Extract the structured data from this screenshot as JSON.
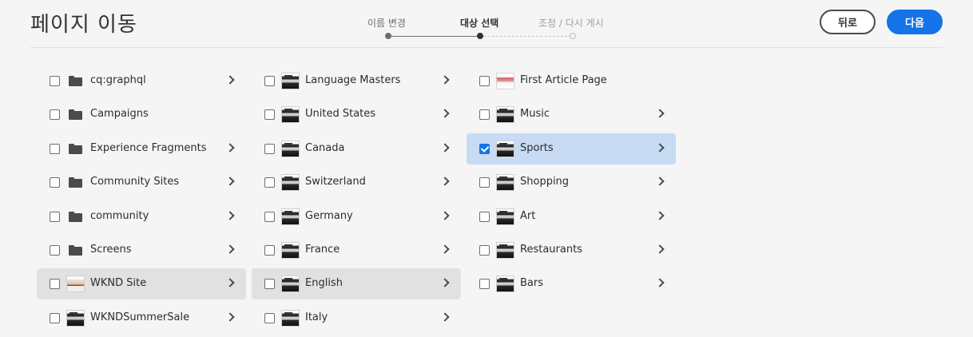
{
  "header": {
    "title": "페이지 이동",
    "steps": [
      {
        "label": "이름 변경",
        "state": "done"
      },
      {
        "label": "대상 선택",
        "state": "active"
      },
      {
        "label": "조정 / 다시 게시",
        "state": "future"
      }
    ],
    "back_label": "뒤로",
    "next_label": "다음"
  },
  "colors": {
    "accent": "#1473e6",
    "selected_row": "#c8dbf5",
    "path_row": "#e1e1e1"
  },
  "columns": [
    {
      "items": [
        {
          "label": "cq:graphql",
          "icon": "folder-icon",
          "has_children": true,
          "checked": false,
          "highlight": "none"
        },
        {
          "label": "Campaigns",
          "icon": "folder-icon",
          "has_children": false,
          "checked": false,
          "highlight": "none"
        },
        {
          "label": "Experience Fragments",
          "icon": "folder-icon",
          "has_children": true,
          "checked": false,
          "highlight": "none"
        },
        {
          "label": "Community Sites",
          "icon": "folder-icon",
          "has_children": true,
          "checked": false,
          "highlight": "none"
        },
        {
          "label": "community",
          "icon": "folder-icon",
          "has_children": true,
          "checked": false,
          "highlight": "none"
        },
        {
          "label": "Screens",
          "icon": "folder-icon",
          "has_children": true,
          "checked": false,
          "highlight": "none"
        },
        {
          "label": "WKND Site",
          "icon": "wknd-thumbnail-icon",
          "has_children": true,
          "checked": false,
          "highlight": "path"
        },
        {
          "label": "WKNDSummerSale",
          "icon": "page-thumbnail-icon",
          "has_children": true,
          "checked": false,
          "highlight": "none"
        }
      ]
    },
    {
      "items": [
        {
          "label": "Language Masters",
          "icon": "page-thumbnail-icon",
          "has_children": true,
          "checked": false,
          "highlight": "none"
        },
        {
          "label": "United States",
          "icon": "page-thumbnail-icon",
          "has_children": true,
          "checked": false,
          "highlight": "none"
        },
        {
          "label": "Canada",
          "icon": "page-thumbnail-icon",
          "has_children": true,
          "checked": false,
          "highlight": "none"
        },
        {
          "label": "Switzerland",
          "icon": "page-thumbnail-icon",
          "has_children": true,
          "checked": false,
          "highlight": "none"
        },
        {
          "label": "Germany",
          "icon": "page-thumbnail-icon",
          "has_children": true,
          "checked": false,
          "highlight": "none"
        },
        {
          "label": "France",
          "icon": "page-thumbnail-icon",
          "has_children": true,
          "checked": false,
          "highlight": "none"
        },
        {
          "label": "English",
          "icon": "page-thumbnail-icon",
          "has_children": true,
          "checked": false,
          "highlight": "path"
        },
        {
          "label": "Italy",
          "icon": "page-thumbnail-icon",
          "has_children": true,
          "checked": false,
          "highlight": "none"
        }
      ]
    },
    {
      "items": [
        {
          "label": "First Article Page",
          "icon": "article-thumbnail-icon",
          "has_children": false,
          "checked": false,
          "highlight": "none"
        },
        {
          "label": "Music",
          "icon": "page-thumbnail-icon",
          "has_children": true,
          "checked": false,
          "highlight": "none"
        },
        {
          "label": "Sports",
          "icon": "page-thumbnail-icon",
          "has_children": true,
          "checked": true,
          "highlight": "selected"
        },
        {
          "label": "Shopping",
          "icon": "page-thumbnail-icon",
          "has_children": true,
          "checked": false,
          "highlight": "none"
        },
        {
          "label": "Art",
          "icon": "page-thumbnail-icon",
          "has_children": true,
          "checked": false,
          "highlight": "none"
        },
        {
          "label": "Restaurants",
          "icon": "page-thumbnail-icon",
          "has_children": true,
          "checked": false,
          "highlight": "none"
        },
        {
          "label": "Bars",
          "icon": "page-thumbnail-icon",
          "has_children": true,
          "checked": false,
          "highlight": "none"
        }
      ]
    }
  ]
}
